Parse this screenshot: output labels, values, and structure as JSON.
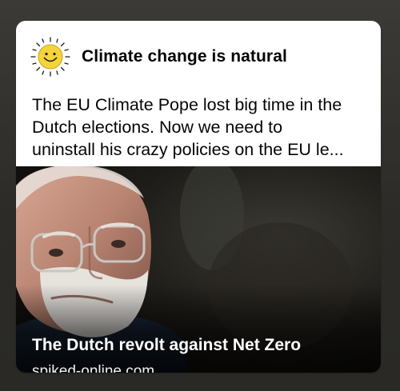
{
  "post": {
    "page_name": "Climate change is natural",
    "avatar_icon": "smiling-sun-icon",
    "text_lines": [
      "The EU Climate Pope lost big time in the",
      "Dutch elections. Now we need to",
      "uninstall his crazy policies on the EU le..."
    ]
  },
  "link_preview": {
    "image_icon": "man-portrait-photo",
    "title": "The Dutch revolt against Net Zero",
    "domain": "spiked-online.com"
  },
  "colors": {
    "background": "#2e2d2a",
    "card": "#ffffff",
    "text": "#050505",
    "sun": "#f5d33a"
  }
}
